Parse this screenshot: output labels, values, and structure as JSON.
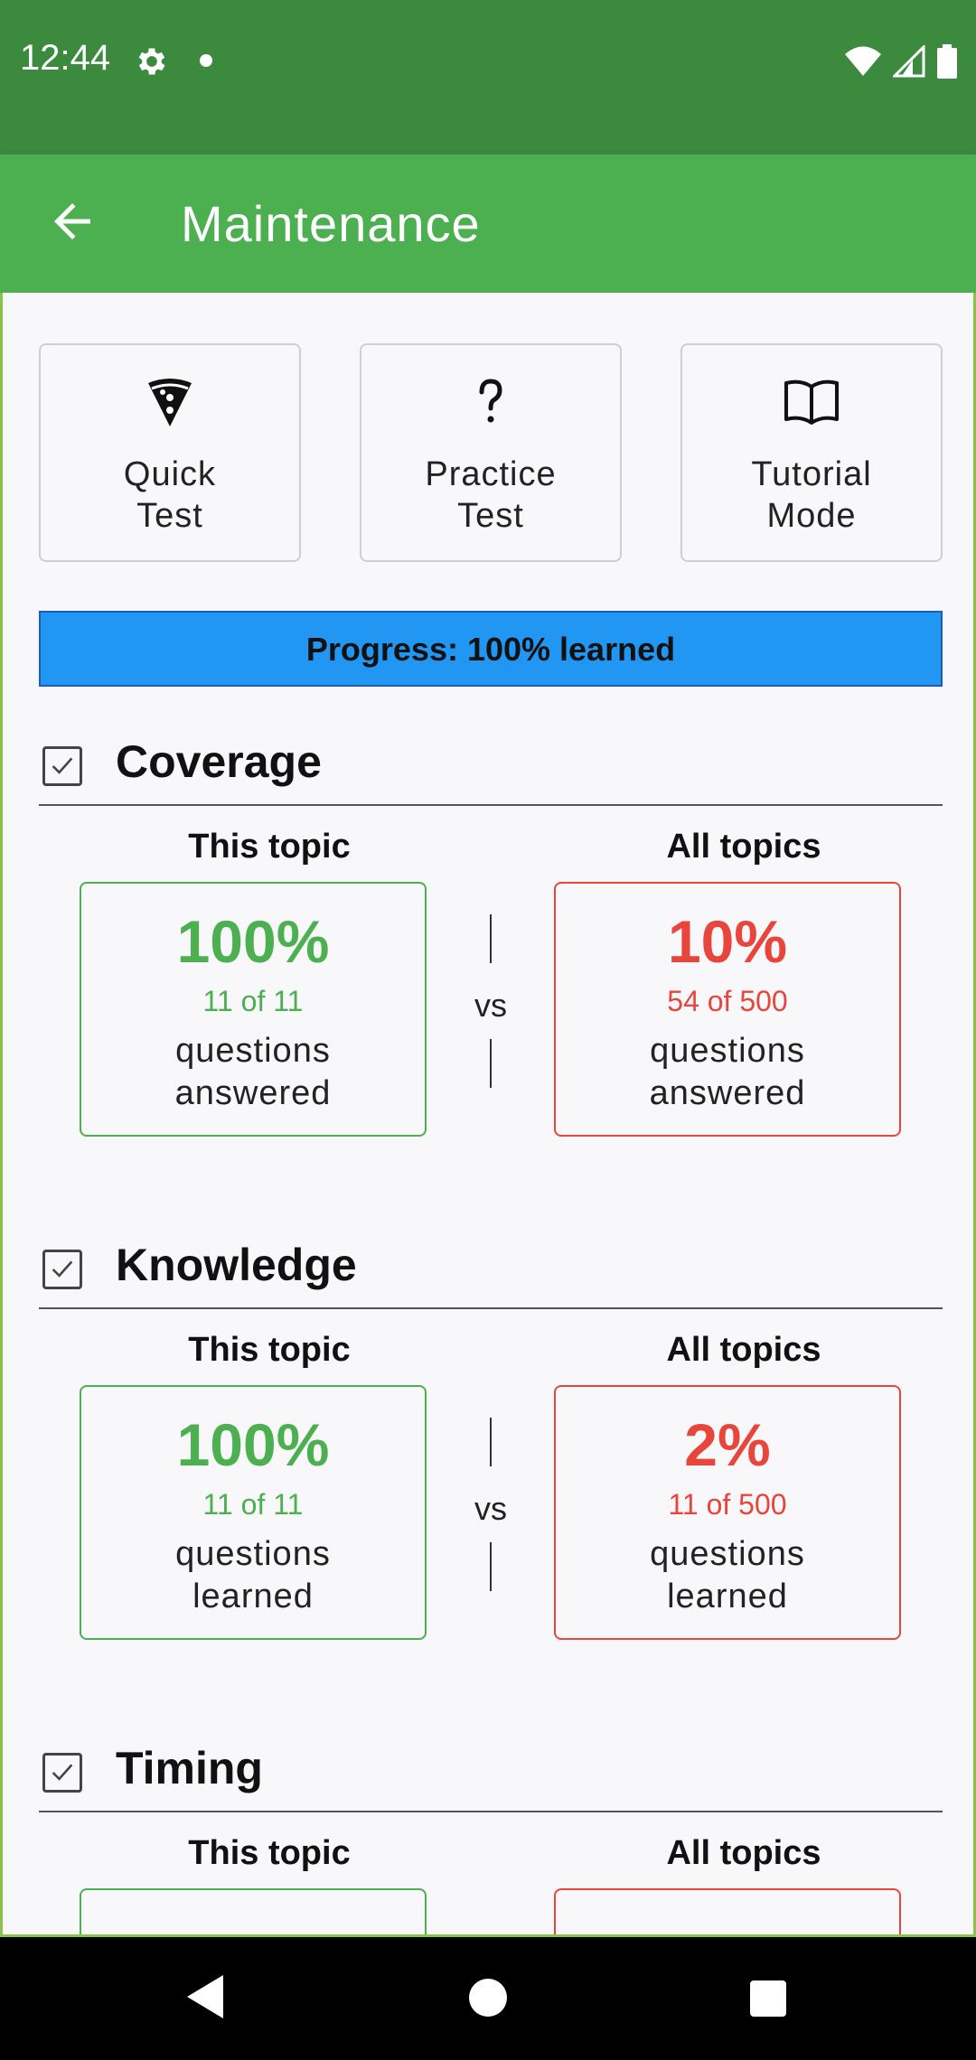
{
  "status_bar": {
    "time": "12:44"
  },
  "app_bar": {
    "title": "Maintenance"
  },
  "modes": [
    {
      "line1": "Quick",
      "line2": "Test",
      "icon": "pizza-slice-icon"
    },
    {
      "line1": "Practice",
      "line2": "Test",
      "icon": "question-mark-icon"
    },
    {
      "line1": "Tutorial",
      "line2": "Mode",
      "icon": "open-book-icon"
    }
  ],
  "progress": {
    "label": "Progress: 100% learned",
    "percent": 100,
    "color": "#2196f3"
  },
  "sections": [
    {
      "title": "Coverage",
      "this_topic_label": "This topic",
      "all_topics_label": "All topics",
      "vs": "vs",
      "this_topic": {
        "pct": "100%",
        "count": "11 of 11",
        "desc1": "questions",
        "desc2": "answered"
      },
      "all_topics": {
        "pct": "10%",
        "count": "54 of 500",
        "desc1": "questions",
        "desc2": "answered"
      }
    },
    {
      "title": "Knowledge",
      "this_topic_label": "This topic",
      "all_topics_label": "All topics",
      "vs": "vs",
      "this_topic": {
        "pct": "100%",
        "count": "11 of 11",
        "desc1": "questions",
        "desc2": "learned"
      },
      "all_topics": {
        "pct": "2%",
        "count": "11 of 500",
        "desc1": "questions",
        "desc2": "learned"
      }
    },
    {
      "title": "Timing",
      "this_topic_label": "This topic",
      "all_topics_label": "All topics"
    }
  ],
  "colors": {
    "good": "#4caf50",
    "bad": "#e8453c",
    "app_bar": "#4caf50",
    "status_bar": "#3b8a3e"
  }
}
